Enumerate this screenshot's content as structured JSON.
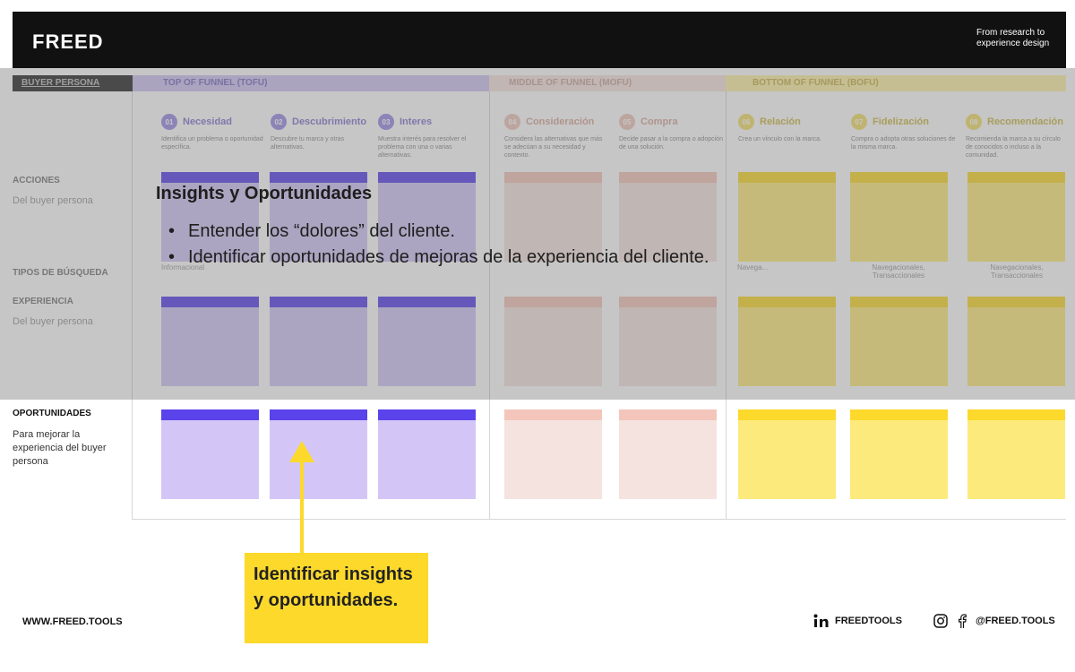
{
  "header": {
    "logo": "FREED",
    "tagline": "From research to experience design"
  },
  "bands": {
    "persona": "BUYER PERSONA",
    "tofu": "TOP OF FUNNEL (TOFU)",
    "mofu": "MIDDLE OF FUNNEL (MOFU)",
    "bofu": "BOTTOM OF FUNNEL (BOFU)"
  },
  "stages": [
    {
      "num": "01",
      "title": "Necesidad",
      "desc": "Identifica un problema o oportunidad específica."
    },
    {
      "num": "02",
      "title": "Descubrimiento",
      "desc": "Descubre tu marca y otras alternativas."
    },
    {
      "num": "03",
      "title": "Interes",
      "desc": "Muestra interés para resolver el problema con una o varias alternativas."
    },
    {
      "num": "04",
      "title": "Consideración",
      "desc": "Considera las alternativas que más se adecúan a su necesidad y contexto."
    },
    {
      "num": "05",
      "title": "Compra",
      "desc": "Decide pasar a la compra o adopción de una solución."
    },
    {
      "num": "06",
      "title": "Relación",
      "desc": "Crea un vínculo con la marca."
    },
    {
      "num": "07",
      "title": "Fidelización",
      "desc": "Compra o adopta otras soluciones de la misma marca."
    },
    {
      "num": "08",
      "title": "Recomendación",
      "desc": "Recomienda la marca a su círculo de conocidos o incluso a la comunidad."
    }
  ],
  "rows": {
    "acciones": "ACCIONES",
    "acciones_sub": "Del buyer persona",
    "tipos": "TIPOS DE BÚSQUEDA",
    "experiencia": "EXPERIENCIA",
    "experiencia_sub": "Del buyer persona",
    "oportunidades": "OPORTUNIDADES",
    "oportunidades_sub": "Para mejorar la experiencia del buyer persona"
  },
  "search_types": {
    "t1": "Informacional",
    "t7": "Navegacionales, Transaccionales",
    "t8": "Navegacionales, Transaccionales",
    "t6": "Navega..."
  },
  "insights": {
    "title": "Insights y Oportunidades",
    "bullets": [
      "Entender los “dolores” del cliente.",
      "Identificar oportunidades de mejoras de la experiencia del cliente."
    ]
  },
  "callout": "Identificar insights y oportunidades.",
  "footer": {
    "url": "WWW.FREED.TOOLS",
    "linkedin": "FREEDTOOLS",
    "social": "@FREED.TOOLS"
  },
  "colors": {
    "tofu": "#5a43ea",
    "mofu": "#f4c5bb",
    "bofu": "#fcd92b",
    "callout": "#fcd92b"
  }
}
